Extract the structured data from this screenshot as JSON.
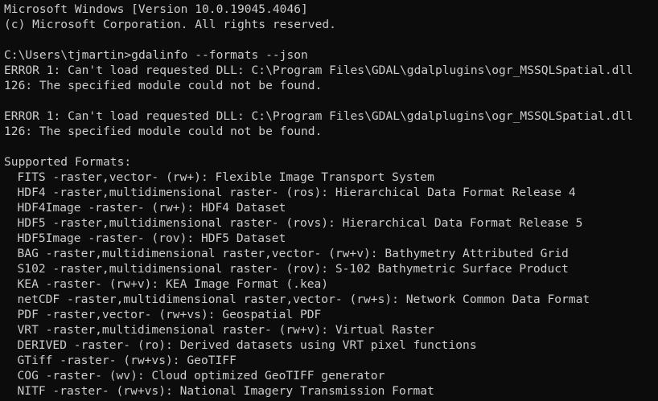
{
  "header": {
    "version_line": "Microsoft Windows [Version 10.0.19045.4046]",
    "copyright_line": "(c) Microsoft Corporation. All rights reserved."
  },
  "prompt": {
    "path": "C:\\Users\\tjmartin>",
    "command": "gdalinfo --formats --json"
  },
  "errors": [
    {
      "line1": "ERROR 1: Can't load requested DLL: C:\\Program Files\\GDAL\\gdalplugins\\ogr_MSSQLSpatial.dll",
      "line2": "126: The specified module could not be found."
    },
    {
      "line1": "ERROR 1: Can't load requested DLL: C:\\Program Files\\GDAL\\gdalplugins\\ogr_MSSQLSpatial.dll",
      "line2": "126: The specified module could not be found."
    }
  ],
  "formats_heading": "Supported Formats:",
  "formats": [
    "FITS -raster,vector- (rw+): Flexible Image Transport System",
    "HDF4 -raster,multidimensional raster- (ros): Hierarchical Data Format Release 4",
    "HDF4Image -raster- (rw+): HDF4 Dataset",
    "HDF5 -raster,multidimensional raster- (rovs): Hierarchical Data Format Release 5",
    "HDF5Image -raster- (rov): HDF5 Dataset",
    "BAG -raster,multidimensional raster,vector- (rw+v): Bathymetry Attributed Grid",
    "S102 -raster,multidimensional raster- (rov): S-102 Bathymetric Surface Product",
    "KEA -raster- (rw+v): KEA Image Format (.kea)",
    "netCDF -raster,multidimensional raster,vector- (rw+s): Network Common Data Format",
    "PDF -raster,vector- (rw+vs): Geospatial PDF",
    "VRT -raster,multidimensional raster- (rw+v): Virtual Raster",
    "DERIVED -raster- (ro): Derived datasets using VRT pixel functions",
    "GTiff -raster- (rw+vs): GeoTIFF",
    "COG -raster- (wv): Cloud optimized GeoTIFF generator",
    "NITF -raster- (rw+vs): National Imagery Transmission Format"
  ],
  "colors": {
    "background": "#0c0c0c",
    "foreground": "#cccccc"
  }
}
